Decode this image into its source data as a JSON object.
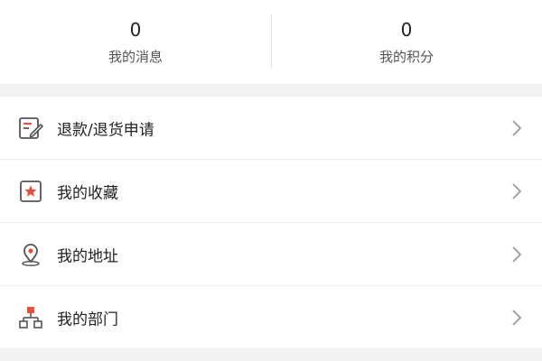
{
  "stats": [
    {
      "value": "0",
      "label": "我的消息"
    },
    {
      "value": "0",
      "label": "我的积分"
    }
  ],
  "menu": [
    {
      "label": "退款/退货申请",
      "icon": "refund-form-icon"
    },
    {
      "label": "我的收藏",
      "icon": "star-favorite-icon"
    },
    {
      "label": "我的地址",
      "icon": "location-pin-icon"
    },
    {
      "label": "我的部门",
      "icon": "org-chart-icon"
    }
  ],
  "colors": {
    "accent": "#e8503a",
    "icon_stroke": "#555555",
    "divider": "#ececec",
    "page_bg": "#f2f2f2"
  }
}
